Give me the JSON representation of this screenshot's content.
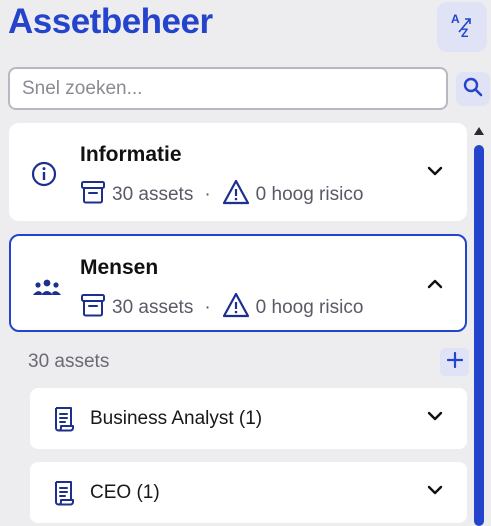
{
  "header": {
    "title": "Assetbeheer",
    "sort_icon": "sort-az-icon"
  },
  "search": {
    "placeholder": "Snel zoeken...",
    "value": ""
  },
  "categories": [
    {
      "name": "Informatie",
      "icon": "info-icon",
      "assets": "30 assets",
      "separator": "·",
      "risk": "0 hoog risico",
      "expanded": false
    },
    {
      "name": "Mensen",
      "icon": "people-icon",
      "assets": "30 assets",
      "separator": "·",
      "risk": "0 hoog risico",
      "expanded": true
    }
  ],
  "expanded_section": {
    "count_label": "30 assets",
    "items": [
      {
        "label": "Business Analyst (1)",
        "icon": "document-icon"
      },
      {
        "label": "CEO (1)",
        "icon": "document-icon"
      }
    ]
  },
  "colors": {
    "accent": "#2444cc",
    "accent_light": "#dfe3f5",
    "background": "#ededf0",
    "card": "#ffffff"
  }
}
